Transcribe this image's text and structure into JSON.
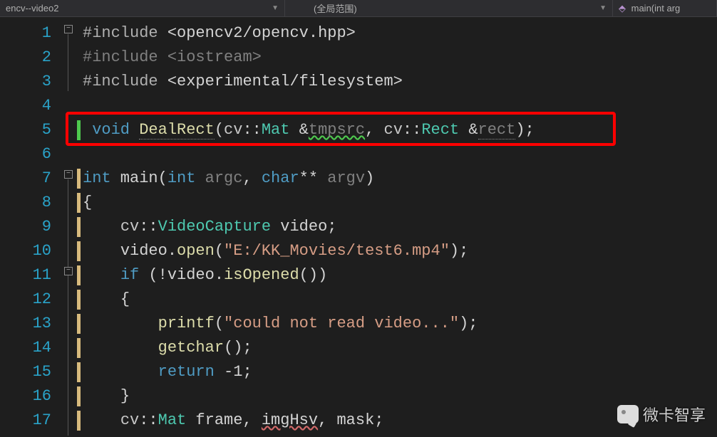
{
  "topbar": {
    "project": "encv--video2",
    "scope": "(全局范围)",
    "member": "main(int arg"
  },
  "gutter": {
    "lines": [
      "1",
      "2",
      "3",
      "4",
      "5",
      "6",
      "7",
      "8",
      "9",
      "10",
      "11",
      "12",
      "13",
      "14",
      "15",
      "16",
      "17"
    ]
  },
  "code": {
    "l1_inc": "#include ",
    "l1_path": "<opencv2/opencv.hpp>",
    "l2_inc": "#include ",
    "l2_path": "<iostream>",
    "l3_inc": "#include ",
    "l3_path": "<experimental/filesystem>",
    "l5_void": "void",
    "l5_func": "DealRect",
    "l5_p_open": "(",
    "l5_ns1": "cv",
    "l5_sep1": "::",
    "l5_type1": "Mat",
    "l5_amp1": " &",
    "l5_arg1": "tmpsrc",
    "l5_comma": ", ",
    "l5_ns2": "cv",
    "l5_sep2": "::",
    "l5_type2": "Rect",
    "l5_amp2": " &",
    "l5_arg2": "rect",
    "l5_close": ");",
    "l7_int": "int",
    "l7_main": " main",
    "l7_popen": "(",
    "l7_pint": "int",
    "l7_argc": " argc",
    "l7_comma": ", ",
    "l7_char": "char",
    "l7_stars": "**",
    "l7_argv": " argv",
    "l7_pclose": ")",
    "l8_brace": "{",
    "l9_ns": "cv",
    "l9_sep": "::",
    "l9_type": "VideoCapture",
    "l9_var": " video",
    "l9_semi": ";",
    "l10_pre": "video.",
    "l10_open": "open",
    "l10_popen": "(",
    "l10_str": "\"E:/KK_Movies/test6.mp4\"",
    "l10_pclose": ");",
    "l11_if": "if",
    "l11_cond": " (!video.",
    "l11_func": "isOpened",
    "l11_end": "())",
    "l12_brace": "{",
    "l13_printf": "printf",
    "l13_popen": "(",
    "l13_str": "\"could not read video...\"",
    "l13_pclose": ");",
    "l14_getchar": "getchar",
    "l14_paren": "();",
    "l15_return": "return",
    "l15_val": " -1;",
    "l16_brace": "}",
    "l17_ns": "cv",
    "l17_sep": "::",
    "l17_type": "Mat",
    "l17_vars1": " frame, ",
    "l17_vars2": "imgHsv",
    "l17_vars3": ", mask;"
  },
  "watermark": "微卡智享"
}
